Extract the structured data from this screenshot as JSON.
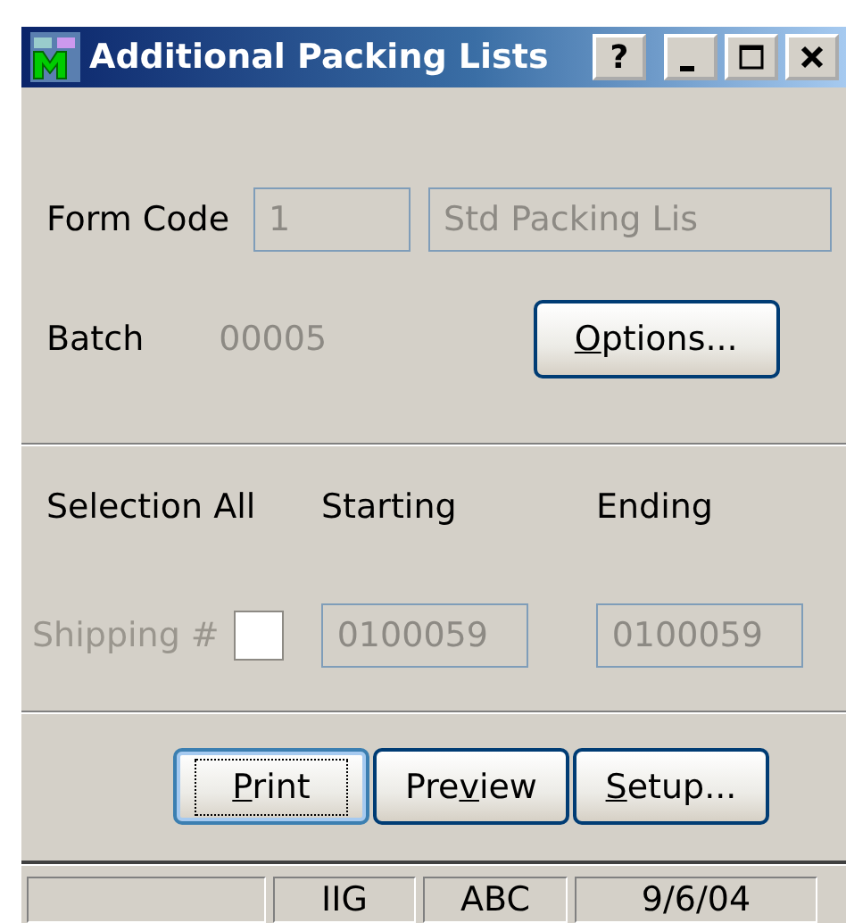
{
  "window": {
    "title": "Additional Packing Lists",
    "controls": [
      {
        "kind": "help",
        "label": "?"
      },
      {
        "kind": "minimize"
      },
      {
        "kind": "maximize"
      },
      {
        "kind": "close"
      }
    ]
  },
  "form_code": {
    "label": "Form Code",
    "code": "1",
    "description": "Std Packing Lis"
  },
  "batch": {
    "label": "Batch",
    "value": "00005"
  },
  "options_button": {
    "access_key": "O",
    "label_after": "ptions...",
    "focused": false
  },
  "selection": {
    "headers": [
      "Selection All",
      "Starting",
      "Ending"
    ],
    "rows": [
      {
        "label": "Shipping #",
        "disabled": true,
        "checked": false,
        "starting": "0100059",
        "ending": "0100059"
      }
    ]
  },
  "buttons": [
    {
      "access_key": "P",
      "label_after": "rint",
      "focused": true
    },
    {
      "label_before": "Pre",
      "access_key": "v",
      "label_after": "iew",
      "focused": false
    },
    {
      "access_key": "S",
      "label_after": "etup...",
      "focused": false
    }
  ],
  "status_bar": [
    "IIG",
    "ABC",
    "9/6/04"
  ]
}
